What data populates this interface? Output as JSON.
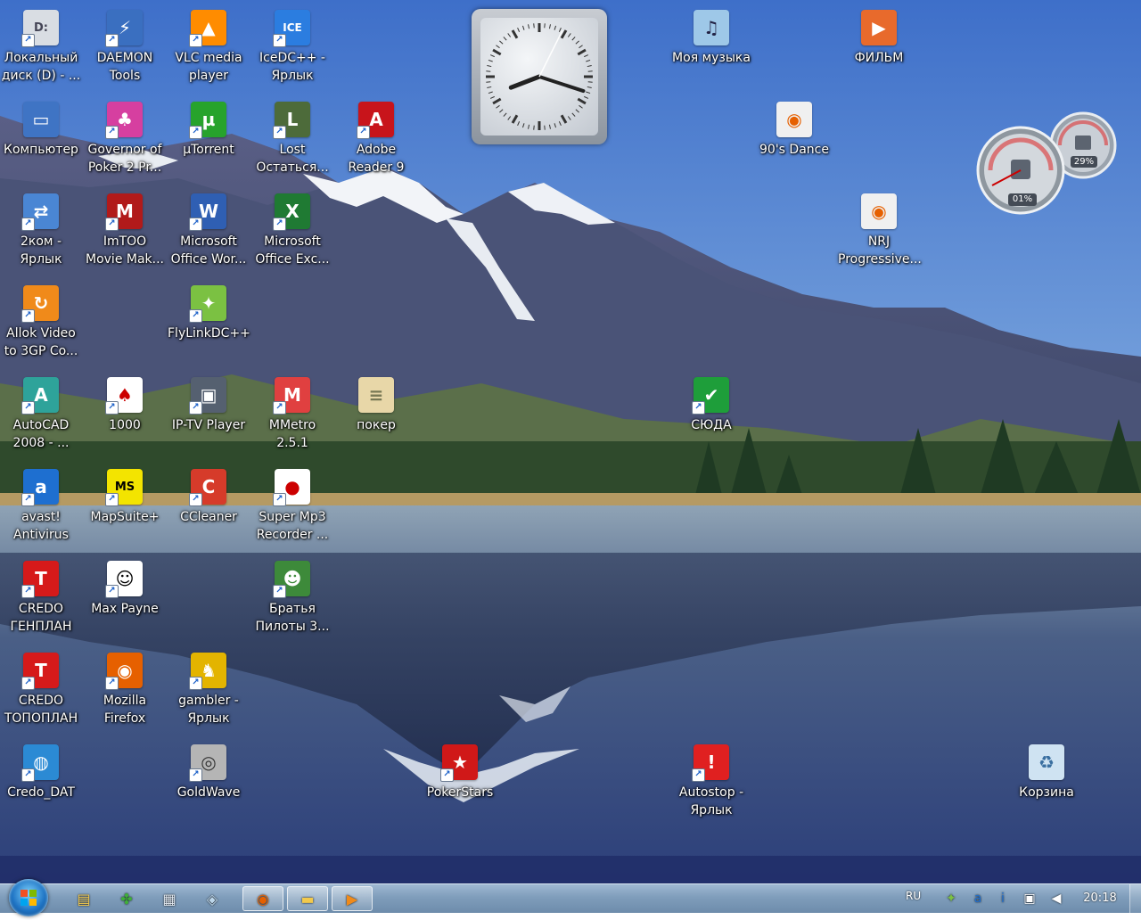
{
  "desktop": {
    "icons": [
      {
        "id": "local-disk",
        "label": [
          "Локальный",
          "диск (D) - ..."
        ],
        "icon": "drive-icon",
        "color": "#d9dde3",
        "fg": "#445",
        "text": "D:"
      },
      {
        "id": "daemon-tools",
        "label": [
          "DAEMON",
          "Tools"
        ],
        "icon": "lightning-disc-icon",
        "color": "#3a6fc0",
        "fg": "#fff",
        "text": "⚡"
      },
      {
        "id": "vlc",
        "label": [
          "VLC media",
          "player"
        ],
        "icon": "traffic-cone-icon",
        "color": "#ff8c00",
        "fg": "#fff",
        "text": "▲"
      },
      {
        "id": "icedc",
        "label": [
          "IceDC++ -",
          "Ярлык"
        ],
        "icon": "ice-icon",
        "color": "#2b7de0",
        "fg": "#fff",
        "text": "ICE"
      },
      {
        "id": "my-music",
        "label": [
          "Моя музыка"
        ],
        "icon": "music-disc-icon",
        "color": "#9ec8e8",
        "fg": "#224",
        "text": "♫"
      },
      {
        "id": "film",
        "label": [
          "ФИЛЬМ"
        ],
        "icon": "video-file-icon",
        "color": "#e86a2c",
        "fg": "#fff",
        "text": "▶"
      },
      {
        "id": "computer",
        "label": [
          "Компьютер"
        ],
        "icon": "computer-icon",
        "color": "#3f74c4",
        "fg": "#fff",
        "text": "▭"
      },
      {
        "id": "governor-poker",
        "label": [
          "Governor of",
          "Poker 2 Pr..."
        ],
        "icon": "poker-chips-icon",
        "color": "#d63fa0",
        "fg": "#fff",
        "text": "♣"
      },
      {
        "id": "utorrent",
        "label": [
          "µTorrent"
        ],
        "icon": "utorrent-icon",
        "color": "#27a32c",
        "fg": "#fff",
        "text": "µ"
      },
      {
        "id": "lost",
        "label": [
          "Lost",
          "Остаться..."
        ],
        "icon": "book-cover-icon",
        "color": "#4d6b3a",
        "fg": "#fff",
        "text": "L"
      },
      {
        "id": "adobe-reader",
        "label": [
          "Adobe",
          "Reader 9"
        ],
        "icon": "pdf-icon",
        "color": "#c8141b",
        "fg": "#fff",
        "text": "A"
      },
      {
        "id": "90s-dance",
        "label": [
          "90's Dance"
        ],
        "icon": "firefox-file-icon",
        "color": "#f0f0f0",
        "fg": "#e66000",
        "text": "◉"
      },
      {
        "id": "2kom",
        "label": [
          "2ком -",
          "Ярлык"
        ],
        "icon": "network-icon",
        "color": "#4a86d4",
        "fg": "#fff",
        "text": "⇄"
      },
      {
        "id": "imtoo",
        "label": [
          "ImTOO",
          "Movie Mak..."
        ],
        "icon": "film-strip-icon",
        "color": "#b11a1a",
        "fg": "#fff",
        "text": "M"
      },
      {
        "id": "word",
        "label": [
          "Microsoft",
          "Office Wor..."
        ],
        "icon": "word-icon",
        "color": "#2f5fb3",
        "fg": "#fff",
        "text": "W"
      },
      {
        "id": "excel",
        "label": [
          "Microsoft",
          "Office Exc..."
        ],
        "icon": "excel-icon",
        "color": "#1f7a33",
        "fg": "#fff",
        "text": "X"
      },
      {
        "id": "nrj",
        "label": [
          "NRJ",
          "Progressive..."
        ],
        "icon": "firefox-file-icon",
        "color": "#f0f0f0",
        "fg": "#e66000",
        "text": "◉"
      },
      {
        "id": "allok",
        "label": [
          "Allok Video",
          "to 3GP Co..."
        ],
        "icon": "convert-icon",
        "color": "#f08a1a",
        "fg": "#fff",
        "text": "↻"
      },
      {
        "id": "flylink",
        "label": [
          "FlyLinkDC++"
        ],
        "icon": "butterfly-icon",
        "color": "#7bc142",
        "fg": "#fff",
        "text": "✦"
      },
      {
        "id": "autocad",
        "label": [
          "AutoCAD",
          "2008 - ..."
        ],
        "icon": "autocad-icon",
        "color": "#2ea39a",
        "fg": "#fff",
        "text": "A"
      },
      {
        "id": "1000",
        "label": [
          "1000"
        ],
        "icon": "playing-cards-icon",
        "color": "#ffffff",
        "fg": "#c00",
        "text": "♠"
      },
      {
        "id": "iptv",
        "label": [
          "IP-TV Player"
        ],
        "icon": "tv-icon",
        "color": "#556070",
        "fg": "#fff",
        "text": "▣"
      },
      {
        "id": "mmetro",
        "label": [
          "MMetro 2.5.1"
        ],
        "icon": "metro-icon",
        "color": "#e04040",
        "fg": "#fff",
        "text": "M"
      },
      {
        "id": "poker-file",
        "label": [
          "покер"
        ],
        "icon": "text-file-icon",
        "color": "#e8d7a8",
        "fg": "#775",
        "text": "≡"
      },
      {
        "id": "syuda",
        "label": [
          "СЮДА"
        ],
        "icon": "shield-icon",
        "color": "#1e9e3a",
        "fg": "#fff",
        "text": "✔"
      },
      {
        "id": "avast",
        "label": [
          "avast!",
          "Antivirus"
        ],
        "icon": "avast-icon",
        "color": "#1e6fd0",
        "fg": "#fff",
        "text": "a"
      },
      {
        "id": "mapsuite",
        "label": [
          "MapSuite+"
        ],
        "icon": "mapsuite-icon",
        "color": "#f3e400",
        "fg": "#000",
        "text": "MS"
      },
      {
        "id": "ccleaner",
        "label": [
          "CCleaner"
        ],
        "icon": "ccleaner-icon",
        "color": "#d63b2a",
        "fg": "#fff",
        "text": "C"
      },
      {
        "id": "super-mp3",
        "label": [
          "Super Mp3",
          "Recorder ..."
        ],
        "icon": "record-icon",
        "color": "#ffffff",
        "fg": "#c00",
        "text": "●"
      },
      {
        "id": "credo-genplan",
        "label": [
          "CREDO",
          "ГЕНПЛАН"
        ],
        "icon": "credo-icon",
        "color": "#d61a1a",
        "fg": "#fff",
        "text": "T"
      },
      {
        "id": "max-payne",
        "label": [
          "Max Payne"
        ],
        "icon": "face-icon",
        "color": "#ffffff",
        "fg": "#000",
        "text": "☺"
      },
      {
        "id": "bratya-piloty",
        "label": [
          "Братья",
          "Пилоты 3..."
        ],
        "icon": "pilot-icon",
        "color": "#3d8a3a",
        "fg": "#fff",
        "text": "☻"
      },
      {
        "id": "credo-topoplan",
        "label": [
          "CREDO",
          "ТОПОПЛАН"
        ],
        "icon": "credo-icon",
        "color": "#d61a1a",
        "fg": "#fff",
        "text": "T"
      },
      {
        "id": "firefox",
        "label": [
          "Mozilla",
          "Firefox"
        ],
        "icon": "firefox-icon",
        "color": "#e66000",
        "fg": "#fff",
        "text": "◉"
      },
      {
        "id": "gambler",
        "label": [
          "gambler -",
          "Ярлык"
        ],
        "icon": "elephant-icon",
        "color": "#e3b400",
        "fg": "#fff",
        "text": "♞"
      },
      {
        "id": "credo-dat",
        "label": [
          "Credo_DAT"
        ],
        "icon": "globe-icon",
        "color": "#2b8ad4",
        "fg": "#fff",
        "text": "◍"
      },
      {
        "id": "goldwave",
        "label": [
          "GoldWave"
        ],
        "icon": "goldwave-icon",
        "color": "#b5b5b5",
        "fg": "#333",
        "text": "◎"
      },
      {
        "id": "pokerstars",
        "label": [
          "PokerStars"
        ],
        "icon": "pokerstars-icon",
        "color": "#d01818",
        "fg": "#fff",
        "text": "★"
      },
      {
        "id": "autostop",
        "label": [
          "Autostop -",
          "Ярлык"
        ],
        "icon": "autostop-icon",
        "color": "#e02020",
        "fg": "#fff",
        "text": "!"
      },
      {
        "id": "recycle-bin",
        "label": [
          "Корзина"
        ],
        "icon": "recycle-bin-icon",
        "color": "#cfe3f2",
        "fg": "#3a6fa0",
        "text": "♻"
      }
    ]
  },
  "gadgets": {
    "clock": {
      "hour": 8,
      "minute": 18
    },
    "cpu": {
      "cpu_label": "01%",
      "memory_label": "29%"
    }
  },
  "taskbar": {
    "pinned": [
      {
        "id": "explorer-folder",
        "icon": "folder-icon",
        "glyph": "▤",
        "color": "#f2c94c",
        "open": false
      },
      {
        "id": "clover-app",
        "icon": "clover-icon",
        "glyph": "✤",
        "color": "#3fae3a",
        "open": false
      },
      {
        "id": "calculator",
        "icon": "calculator-icon",
        "glyph": "▦",
        "color": "#dfe6ee",
        "open": false
      },
      {
        "id": "disk-tool",
        "icon": "disk-icon",
        "glyph": "◈",
        "color": "#bcd6ea",
        "open": false
      },
      {
        "id": "firefox-task",
        "icon": "firefox-icon",
        "glyph": "◉",
        "color": "#e66000",
        "open": true
      },
      {
        "id": "folder-task",
        "icon": "folder-icon",
        "glyph": "▬",
        "color": "#f2c94c",
        "open": true
      },
      {
        "id": "media-task",
        "icon": "media-player-icon",
        "glyph": "▶",
        "color": "#f08a1a",
        "open": true
      }
    ],
    "language": "RU",
    "tray": [
      {
        "id": "flylink-tray",
        "icon": "butterfly-icon",
        "glyph": "✦",
        "color": "#7bc142"
      },
      {
        "id": "avast-tray",
        "icon": "avast-icon",
        "glyph": "a",
        "color": "#1e6fd0"
      },
      {
        "id": "info-tray",
        "icon": "info-icon",
        "glyph": "i",
        "color": "#1e6fd0"
      },
      {
        "id": "network-tray",
        "icon": "network-icon",
        "glyph": "▣",
        "color": "#ffffff"
      },
      {
        "id": "volume-tray",
        "icon": "volume-icon",
        "glyph": "◀",
        "color": "#ffffff"
      }
    ],
    "time": "20:18"
  }
}
